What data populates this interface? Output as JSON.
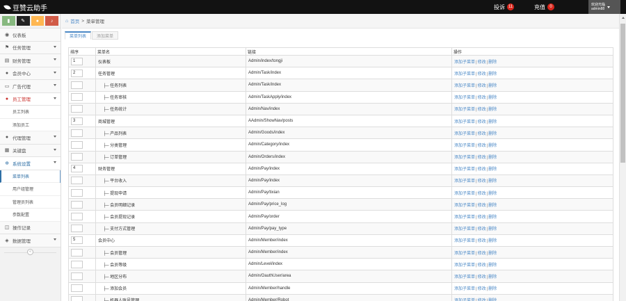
{
  "brand": {
    "title": "豆赞云助手"
  },
  "topnav": {
    "items": [
      {
        "label": "投诉",
        "badge": "11"
      },
      {
        "label": "充值",
        "badge": "0"
      }
    ],
    "user": {
      "line1": "欢迎光临",
      "line2": "admin88"
    }
  },
  "sidebar": {
    "shortcuts": [
      {
        "icon": "chart-icon",
        "color": "#87b87f"
      },
      {
        "icon": "pencil-icon",
        "color": "#222222"
      },
      {
        "icon": "users-icon",
        "color": "#ffb752"
      },
      {
        "icon": "bell-icon",
        "color": "#d15b47"
      }
    ],
    "items": [
      {
        "label": "仪表板",
        "icon": "dashboard-icon",
        "arrow": false
      },
      {
        "label": "任务管理",
        "icon": "flag-icon",
        "arrow": true
      },
      {
        "label": "财务管理",
        "icon": "money-icon",
        "arrow": true
      },
      {
        "label": "会员中心",
        "icon": "user-icon",
        "arrow": true
      },
      {
        "label": "广告代理",
        "icon": "card-icon",
        "arrow": true
      },
      {
        "label": "员工管理",
        "icon": "staff-icon",
        "arrow": true,
        "state": "open-red"
      },
      {
        "label": "代理管理",
        "icon": "agent-icon",
        "arrow": true
      },
      {
        "label": "关键盘",
        "icon": "keyboard-icon",
        "arrow": true
      },
      {
        "label": "系统设置",
        "icon": "gear-icon",
        "arrow": true,
        "state": "open-blue"
      },
      {
        "label": "操作记录",
        "icon": "bookmark-icon",
        "arrow": false
      },
      {
        "label": "数据管理",
        "icon": "database-icon",
        "arrow": true
      }
    ],
    "staff_sub": [
      "员工列表",
      "添加员工"
    ],
    "system_sub": [
      {
        "label": "菜单列表",
        "active": true
      },
      {
        "label": "用户组管理",
        "active": false
      },
      {
        "label": "管理员列表",
        "active": false
      },
      {
        "label": "参数配置",
        "active": false
      }
    ],
    "collapse_label": "«"
  },
  "breadcrumb": {
    "home": "首页",
    "sep": ">",
    "current": "菜单管理"
  },
  "tabs": [
    {
      "label": "菜单列表",
      "active": true
    },
    {
      "label": "添加菜单",
      "active": false
    }
  ],
  "table": {
    "headers": [
      "排序",
      "菜单名",
      "链接",
      "操作"
    ],
    "ops": {
      "add": "添加子菜单",
      "edit": "修改",
      "del": "删除",
      "sep": "|"
    },
    "rows": [
      {
        "sort": "1",
        "name": "仪表板",
        "link": "Admin/index/tongji",
        "child": false
      },
      {
        "sort": "2",
        "name": "任务管理",
        "link": "Admin/Task/index",
        "child": false
      },
      {
        "sort": "",
        "name": "├─ 任务列表",
        "link": "Admin/Task/index",
        "child": true
      },
      {
        "sort": "",
        "name": "├─ 任务审核",
        "link": "Admin/TaskApply/index",
        "child": true
      },
      {
        "sort": "",
        "name": "├─ 任务统计",
        "link": "Admin/Nav/index",
        "child": true
      },
      {
        "sort": "3",
        "name": "商城管理",
        "link": "AAdmin/ShowNav/posts",
        "child": false
      },
      {
        "sort": "",
        "name": "├─ 产品列表",
        "link": "Admin/Goods/index",
        "child": true
      },
      {
        "sort": "",
        "name": "├─ 分类管理",
        "link": "Admin/Category/index",
        "child": true
      },
      {
        "sort": "",
        "name": "├─ 订单管理",
        "link": "Admin/Orders/index",
        "child": true
      },
      {
        "sort": "4",
        "name": "财务管理",
        "link": "Admin/Pay/index",
        "child": false
      },
      {
        "sort": "",
        "name": "├─ 平台收入",
        "link": "Admin/Pay/index",
        "child": true
      },
      {
        "sort": "",
        "name": "├─ 提现申请",
        "link": "Admin/Pay/tixian",
        "child": true
      },
      {
        "sort": "",
        "name": "├─ 会员明细记录",
        "link": "Admin/Pay/price_log",
        "child": true
      },
      {
        "sort": "",
        "name": "├─ 会员提现记录",
        "link": "Admin/Pay/order",
        "child": true
      },
      {
        "sort": "",
        "name": "├─ 支付方式管理",
        "link": "Admin/Pay/pay_type",
        "child": true
      },
      {
        "sort": "5",
        "name": "会员中心",
        "link": "Admin/Member/index",
        "child": false
      },
      {
        "sort": "",
        "name": "├─ 会员管理",
        "link": "Admin/Member/index",
        "child": true
      },
      {
        "sort": "",
        "name": "├─ 会员等级",
        "link": "Admin/Level/index",
        "child": true
      },
      {
        "sort": "",
        "name": "├─ 地区分布",
        "link": "Admin/OauthUser/area",
        "child": true
      },
      {
        "sort": "",
        "name": "├─ 添加会员",
        "link": "Admin/Member/handle",
        "child": true
      },
      {
        "sort": "",
        "name": "├─ 机器人账号管理",
        "link": "Admin/Member/Robot",
        "child": true
      }
    ]
  }
}
